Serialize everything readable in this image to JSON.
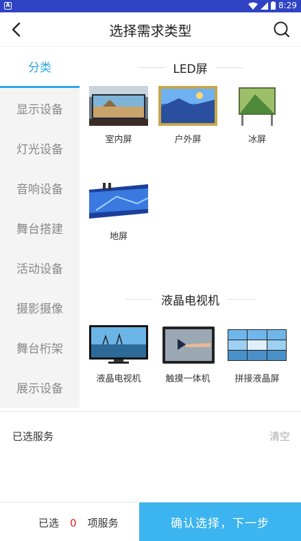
{
  "statusbar": {
    "time": "8:29"
  },
  "header": {
    "title": "选择需求类型"
  },
  "sidebar": {
    "items": [
      {
        "label": "分类"
      },
      {
        "label": "显示设备"
      },
      {
        "label": "灯光设备"
      },
      {
        "label": "音响设备"
      },
      {
        "label": "舞台搭建"
      },
      {
        "label": "活动设备"
      },
      {
        "label": "摄影摄像"
      },
      {
        "label": "舞台桁架"
      },
      {
        "label": "展示设备"
      }
    ]
  },
  "sections": [
    {
      "title": "LED屏",
      "items": [
        {
          "label": "室内屏"
        },
        {
          "label": "户外屏"
        },
        {
          "label": "冰屏"
        },
        {
          "label": "地屏"
        }
      ]
    },
    {
      "title": "液晶电视机",
      "items": [
        {
          "label": "液晶电视机"
        },
        {
          "label": "触摸一体机"
        },
        {
          "label": "拼接液晶屏"
        }
      ]
    }
  ],
  "selected": {
    "label": "已选服务",
    "clear": "清空"
  },
  "bottom": {
    "prefix": "已选",
    "count": "0",
    "suffix": "项服务",
    "confirm": "确认选择，下一步"
  }
}
